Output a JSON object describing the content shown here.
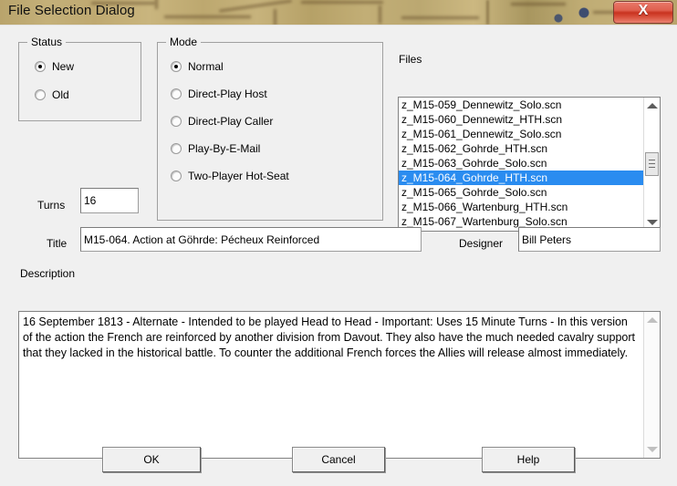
{
  "window": {
    "title": "File Selection Dialog",
    "close_label": "X",
    "close_icon": "close-icon"
  },
  "status_group": {
    "legend": "Status",
    "options": [
      {
        "label": "New",
        "checked": true
      },
      {
        "label": "Old",
        "checked": false
      }
    ]
  },
  "mode_group": {
    "legend": "Mode",
    "options": [
      {
        "label": "Normal",
        "checked": true
      },
      {
        "label": "Direct-Play Host",
        "checked": false
      },
      {
        "label": "Direct-Play Caller",
        "checked": false
      },
      {
        "label": "Play-By-E-Mail",
        "checked": false
      },
      {
        "label": "Two-Player Hot-Seat",
        "checked": false
      }
    ]
  },
  "turns": {
    "label": "Turns",
    "value": "16"
  },
  "files": {
    "label": "Files",
    "items": [
      {
        "name": "z_M15-059_Dennewitz_Solo.scn",
        "selected": false
      },
      {
        "name": "z_M15-060_Dennewitz_HTH.scn",
        "selected": false
      },
      {
        "name": "z_M15-061_Dennewitz_Solo.scn",
        "selected": false
      },
      {
        "name": "z_M15-062_Gohrde_HTH.scn",
        "selected": false
      },
      {
        "name": "z_M15-063_Gohrde_Solo.scn",
        "selected": false
      },
      {
        "name": "z_M15-064_Gohrde_HTH.scn",
        "selected": true
      },
      {
        "name": "z_M15-065_Gohrde_Solo.scn",
        "selected": false
      },
      {
        "name": "z_M15-066_Wartenburg_HTH.scn",
        "selected": false
      },
      {
        "name": "z_M15-067_Wartenburg_Solo.scn",
        "selected": false
      }
    ],
    "selection_color": "#2a8cf0",
    "scroll_up_icon": "triangle-up-icon",
    "scroll_down_icon": "triangle-down-icon"
  },
  "title_field": {
    "label": "Title",
    "value": "M15-064. Action at Göhrde: Pécheux Reinforced"
  },
  "designer_field": {
    "label": "Designer",
    "value": "Bill Peters"
  },
  "description": {
    "label": "Description",
    "value": "16 September 1813 - Alternate - Intended to be played Head to Head - Important: Uses 15 Minute Turns - In this version of the action the French are reinforced by another division from Davout. They also have the much needed cavalry support that they lacked in the historical battle. To counter the additional French forces the Allies will release almost immediately.",
    "scroll_up_icon": "triangle-up-icon",
    "scroll_down_icon": "triangle-down-icon"
  },
  "buttons": {
    "ok": "OK",
    "cancel": "Cancel",
    "help": "Help"
  }
}
